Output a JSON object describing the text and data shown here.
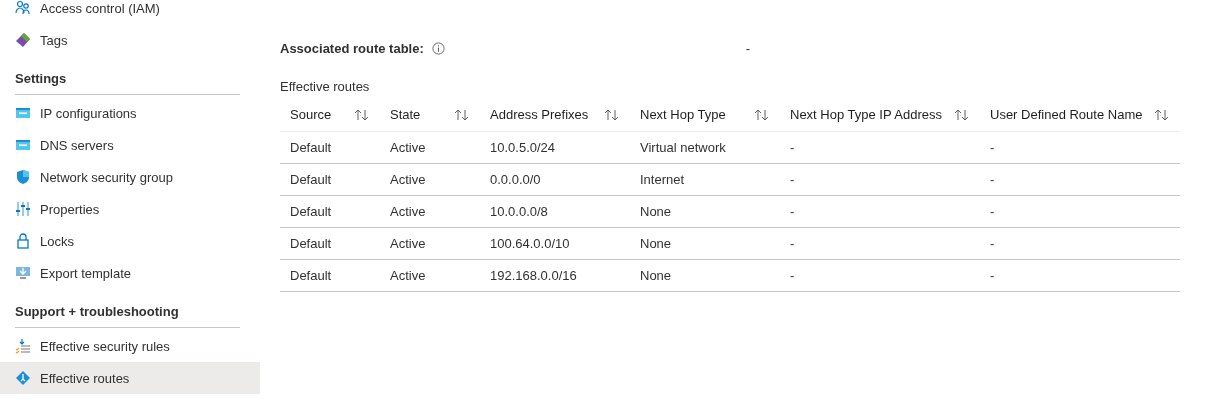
{
  "sidebar": {
    "items": [
      {
        "label": "Access control (IAM)",
        "selected": false
      },
      {
        "label": "Tags",
        "selected": false
      }
    ],
    "sections": [
      {
        "title": "Settings",
        "items": [
          {
            "label": "IP configurations",
            "selected": false
          },
          {
            "label": "DNS servers",
            "selected": false
          },
          {
            "label": "Network security group",
            "selected": false
          },
          {
            "label": "Properties",
            "selected": false
          },
          {
            "label": "Locks",
            "selected": false
          },
          {
            "label": "Export template",
            "selected": false
          }
        ]
      },
      {
        "title": "Support + troubleshooting",
        "items": [
          {
            "label": "Effective security rules",
            "selected": false
          },
          {
            "label": "Effective routes",
            "selected": true
          }
        ]
      }
    ]
  },
  "details": {
    "label": "Associated route table:",
    "value": "-"
  },
  "routes": {
    "title": "Effective routes",
    "columns": [
      "Source",
      "State",
      "Address Prefixes",
      "Next Hop Type",
      "Next Hop Type IP Address",
      "User Defined Route Name"
    ],
    "rows": [
      [
        "Default",
        "Active",
        "10.0.5.0/24",
        "Virtual network",
        "-",
        "-"
      ],
      [
        "Default",
        "Active",
        "0.0.0.0/0",
        "Internet",
        "-",
        "-"
      ],
      [
        "Default",
        "Active",
        "10.0.0.0/8",
        "None",
        "-",
        "-"
      ],
      [
        "Default",
        "Active",
        "100.64.0.0/10",
        "None",
        "-",
        "-"
      ],
      [
        "Default",
        "Active",
        "192.168.0.0/16",
        "None",
        "-",
        "-"
      ]
    ]
  }
}
